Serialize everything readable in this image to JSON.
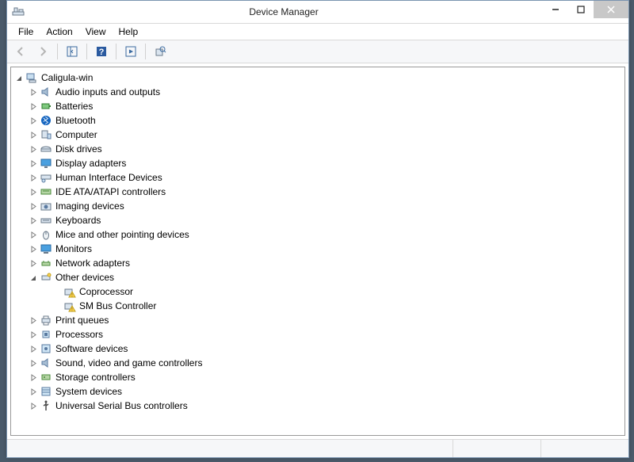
{
  "window": {
    "title": "Device Manager"
  },
  "menu": {
    "file": "File",
    "action": "Action",
    "view": "View",
    "help": "Help"
  },
  "tree": {
    "root": "Caligula-win",
    "items": [
      "Audio inputs and outputs",
      "Batteries",
      "Bluetooth",
      "Computer",
      "Disk drives",
      "Display adapters",
      "Human Interface Devices",
      "IDE ATA/ATAPI controllers",
      "Imaging devices",
      "Keyboards",
      "Mice and other pointing devices",
      "Monitors",
      "Network adapters",
      "Other devices",
      "Print queues",
      "Processors",
      "Software devices",
      "Sound, video and game controllers",
      "Storage controllers",
      "System devices",
      "Universal Serial Bus controllers"
    ],
    "other_children": [
      "Coprocessor",
      "SM Bus Controller"
    ]
  }
}
